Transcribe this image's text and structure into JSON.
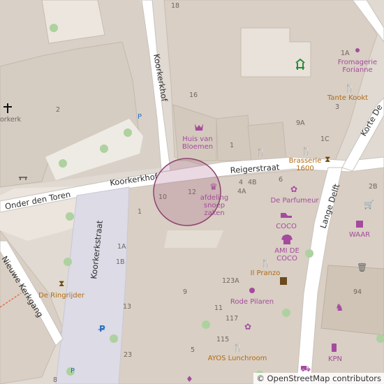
{
  "map": {
    "colors": {
      "background": "#e0dad2",
      "building": "#d9cfc4",
      "building_stroke": "#c8bcb0",
      "road": "#ffffff",
      "pedestrian": "#dddde8",
      "grass_dot": "#aed1a0",
      "park_area": "#f2efe9",
      "marker_fill": "#a0517a",
      "poi_purple": "#a44b9e",
      "food_brown": "#b36a14"
    },
    "streets": [
      {
        "name": "Koorkerkhof"
      },
      {
        "name": "Onder den Toren"
      },
      {
        "name": "Reigerstraat"
      },
      {
        "name": "Koorkerkstraat"
      },
      {
        "name": "Lange Delft"
      },
      {
        "name": "Korte De"
      },
      {
        "name": "Nieuwe Kerkgang"
      },
      {
        "name": "Koorkerkhof"
      }
    ],
    "house_numbers": [
      "18",
      "16",
      "2",
      "1",
      "10",
      "12",
      "4",
      "4B",
      "4A",
      "6",
      "3",
      "9A",
      "1C",
      "1A",
      "1",
      "1A",
      "1B",
      "123A",
      "13",
      "9",
      "11",
      "117",
      "115",
      "23",
      "5",
      "94",
      "2B",
      "8"
    ],
    "pois": [
      {
        "label": "Huis van\nBloemen",
        "icon": "flower-shop-icon"
      },
      {
        "label": "afdeling\nsnoep\nzaken",
        "icon": "candy-shop-icon"
      },
      {
        "label": "Brasserie\n1600",
        "icon": "cafe-icon"
      },
      {
        "label": "Fromagerie\nForianne",
        "icon": "cheese-shop-icon"
      },
      {
        "label": "Tante Kookt",
        "icon": "restaurant-icon"
      },
      {
        "label": "De Parfumeur",
        "icon": "perfume-icon"
      },
      {
        "label": "COCO",
        "icon": "shoe-icon"
      },
      {
        "label": "AMI DE\nCOCO",
        "icon": "clothes-icon"
      },
      {
        "label": "Il Pranzo",
        "icon": "restaurant-icon"
      },
      {
        "label": "Rode Pilaren",
        "icon": "gift-icon"
      },
      {
        "label": "AYOS Lunchroom",
        "icon": "restaurant-icon"
      },
      {
        "label": "KPN",
        "icon": "phone-shop-icon"
      },
      {
        "label": "WAAR",
        "icon": "gift-icon"
      },
      {
        "label": "De Ringrijder",
        "icon": "hourglass-icon"
      },
      {
        "label": "orkerk",
        "icon": "church-icon"
      }
    ],
    "attribution": "© OpenStreetMap contributors"
  }
}
